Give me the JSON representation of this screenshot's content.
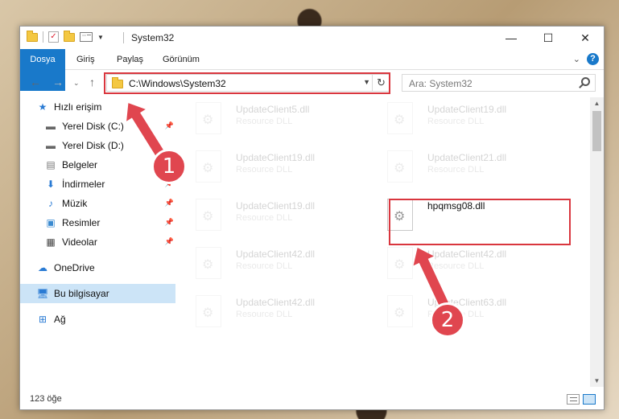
{
  "window": {
    "title": "System32"
  },
  "ribbon": {
    "tabs": [
      "Dosya",
      "Giriş",
      "Paylaş",
      "Görünüm"
    ]
  },
  "address": {
    "path": "C:\\Windows\\System32"
  },
  "search": {
    "placeholder": "Ara: System32"
  },
  "nav": {
    "items": [
      {
        "label": "Hızlı erişim",
        "icon": "star-icon"
      },
      {
        "label": "Yerel Disk (C:)",
        "icon": "drive-icon"
      },
      {
        "label": "Yerel Disk (D:)",
        "icon": "drive-icon"
      },
      {
        "label": "Belgeler",
        "icon": "document-icon"
      },
      {
        "label": "İndirmeler",
        "icon": "download-icon"
      },
      {
        "label": "Müzik",
        "icon": "music-icon"
      },
      {
        "label": "Resimler",
        "icon": "pictures-icon"
      },
      {
        "label": "Videolar",
        "icon": "video-icon"
      },
      {
        "label": "OneDrive",
        "icon": "cloud-icon"
      },
      {
        "label": "Bu bilgisayar",
        "icon": "computer-icon"
      },
      {
        "label": "Ağ",
        "icon": "network-icon"
      }
    ]
  },
  "files": [
    {
      "name": "UpdateClient5.dll",
      "type": "Resource DLL"
    },
    {
      "name": "UpdateClient19.dll",
      "type": "Resource DLL"
    },
    {
      "name": "UpdateClient19.dll",
      "type": "Resource DLL"
    },
    {
      "name": "UpdateClient21.dll",
      "type": "Resource DLL"
    },
    {
      "name": "UpdateClient19.dll",
      "type": "Resource DLL"
    },
    {
      "name": "hpqmsg08.dll",
      "type": ""
    },
    {
      "name": "UpdateClient42.dll",
      "type": "Resource DLL"
    },
    {
      "name": "UpdateClient42.dll",
      "type": "Resource DLL"
    },
    {
      "name": "UpdateClient42.dll",
      "type": "Resource DLL"
    },
    {
      "name": "UpdateClient63.dll",
      "type": "Resource DLL"
    }
  ],
  "status": {
    "count": "123 öğe"
  },
  "annotations": {
    "step1": "1",
    "step2": "2",
    "color": "#e0464f"
  }
}
